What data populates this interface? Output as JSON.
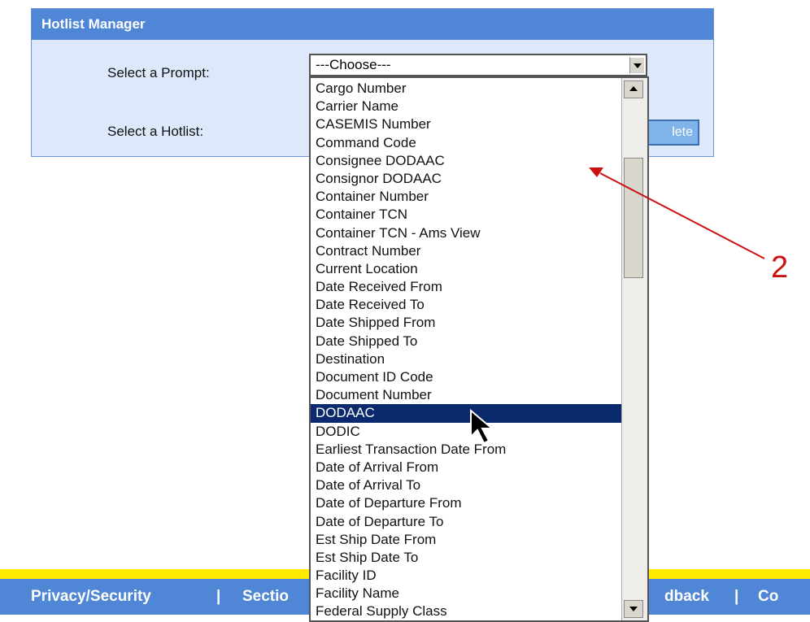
{
  "panel": {
    "title": "Hotlist Manager",
    "prompt_label": "Select a Prompt:",
    "hotlist_label": "Select a Hotlist:",
    "prompt_value": "---Choose---",
    "delete_label": "lete"
  },
  "dropdown": {
    "options": [
      "Cargo Number",
      "Carrier Name",
      "CASEMIS Number",
      "Command Code",
      "Consignee DODAAC",
      "Consignor DODAAC",
      "Container Number",
      "Container TCN",
      "Container TCN - Ams View",
      "Contract Number",
      "Current Location",
      "Date Received From",
      "Date Received To",
      "Date Shipped From",
      "Date Shipped To",
      "Destination",
      "Document ID Code",
      "Document Number",
      "DODAAC",
      "DODIC",
      "Earliest Transaction Date From",
      "Date of Arrival From",
      "Date of Arrival To",
      "Date of Departure From",
      "Date of Departure To",
      "Est Ship Date From",
      "Est Ship Date To",
      "Facility ID",
      "Facility Name",
      "Federal Supply Class"
    ],
    "selected": "DODAAC"
  },
  "footer": {
    "items": [
      "Privacy/Security",
      "|",
      "Sectio",
      "dback",
      "|",
      "Co"
    ]
  },
  "annotation": {
    "number": "2"
  },
  "colors": {
    "panel_bg": "#dde9fb",
    "header_bg": "#4f87d6",
    "selected_bg": "#0b2a6d",
    "footer_yellow": "#ffea00",
    "annotation_red": "#cc1111"
  }
}
